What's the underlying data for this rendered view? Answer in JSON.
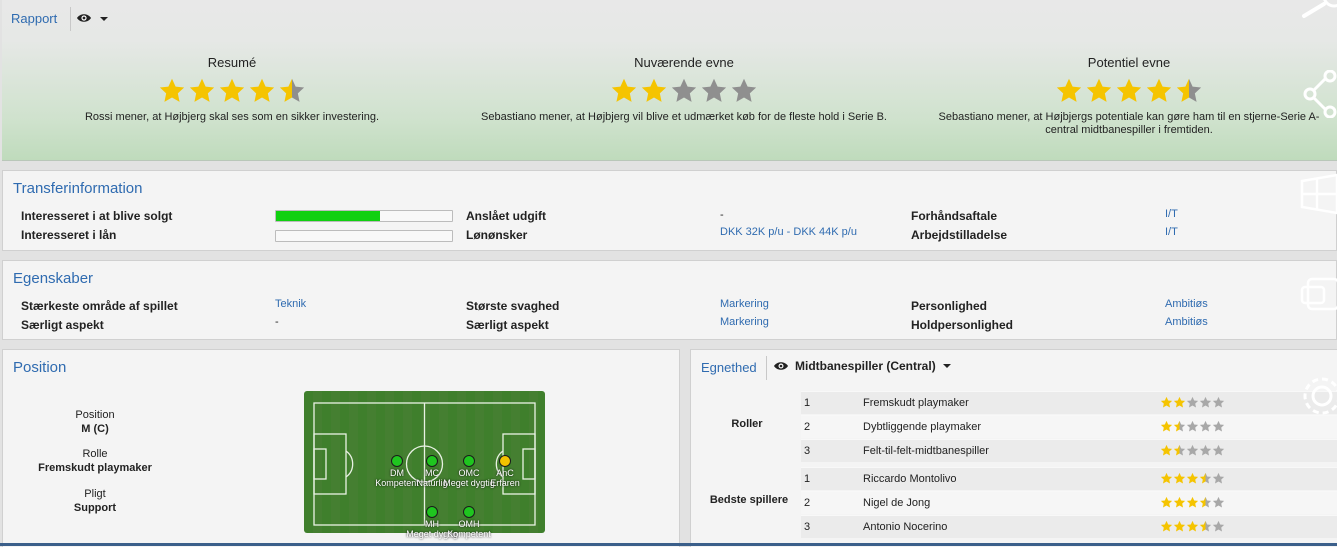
{
  "report": {
    "tab": "Rapport",
    "columns": [
      {
        "title": "Resumé",
        "stars": 4.5,
        "description": "Rossi mener, at Højbjerg skal ses som en sikker investering."
      },
      {
        "title": "Nuværende evne",
        "stars": 2,
        "description": "Sebastiano mener, at Højbjerg vil blive et udmærket køb for de fleste hold i Serie B."
      },
      {
        "title": "Potentiel evne",
        "stars": 4.5,
        "description": "Sebastiano mener, at Højbjergs potentiale kan gøre ham til en stjerne-Serie A-central midtbanespiller i fremtiden."
      }
    ]
  },
  "transfer": {
    "title": "Transferinformation",
    "sold_label": "Interesseret i at blive solgt",
    "sold_level": 0.59,
    "loan_label": "Interesseret i lån",
    "loan_level": 0,
    "fee_label": "Anslået udgift",
    "fee_value": "-",
    "wage_label": "Lønønsker",
    "wage_value": "DKK 32K p/u - DKK 44K p/u",
    "precontract_label": "Forhåndsaftale",
    "precontract_value": "I/T",
    "workpermit_label": "Arbejdstilladelse",
    "workpermit_value": "I/T"
  },
  "attributes": {
    "title": "Egenskaber",
    "strongest_label": "Stærkeste område af spillet",
    "strongest_value": "Teknik",
    "special1_label": "Særligt aspekt",
    "special1_value": "-",
    "weakness_label": "Største svaghed",
    "weakness_value": "Markering",
    "special2_label": "Særligt aspekt",
    "special2_value": "Markering",
    "personality_label": "Personlighed",
    "personality_value": "Ambitiøs",
    "team_personality_label": "Holdpersonlighed",
    "team_personality_value": "Ambitiøs"
  },
  "position": {
    "title": "Position",
    "position_label": "Position",
    "position_value": "M (C)",
    "role_label": "Rolle",
    "role_value": "Fremskudt playmaker",
    "duty_label": "Pligt",
    "duty_value": "Support",
    "pitch_markers": [
      {
        "abbr": "DM",
        "rating": "Kompetent",
        "color": "#1fc51f"
      },
      {
        "abbr": "MC",
        "rating": "Naturlig",
        "color": "#1fc51f"
      },
      {
        "abbr": "OMC",
        "rating": "Meget dygtig",
        "color": "#1fc51f"
      },
      {
        "abbr": "AnC",
        "rating": "Erfaren",
        "color": "#f2c300"
      },
      {
        "abbr": "MH",
        "rating": "Meget dygtig",
        "color": "#1fc51f"
      },
      {
        "abbr": "OMH",
        "rating": "Kompetent",
        "color": "#1fc51f"
      }
    ]
  },
  "suitability": {
    "tab": "Egnethed",
    "selected_position": "Midtbanespiller (Central)",
    "roles_label": "Roller",
    "roles": [
      {
        "num": "1",
        "name": "Fremskudt playmaker",
        "stars": 2
      },
      {
        "num": "2",
        "name": "Dybtliggende playmaker",
        "stars": 1.5
      },
      {
        "num": "3",
        "name": "Felt-til-felt-midtbanespiller",
        "stars": 1.5
      }
    ],
    "best_label": "Bedste spillere",
    "best_players": [
      {
        "num": "1",
        "name": "Riccardo Montolivo",
        "stars": 3.5
      },
      {
        "num": "2",
        "name": "Nigel de Jong",
        "stars": 3.5
      },
      {
        "num": "3",
        "name": "Antonio Nocerino",
        "stars": 3.5
      }
    ]
  }
}
